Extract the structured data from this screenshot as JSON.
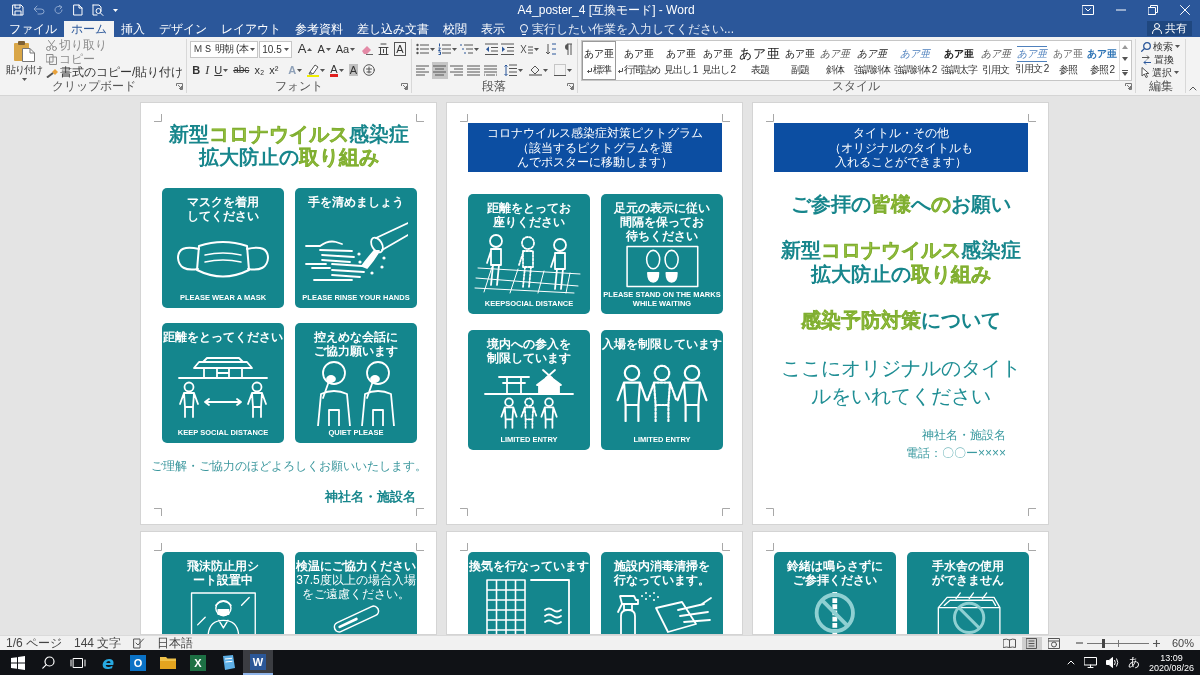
{
  "window": {
    "title": "A4_poster_4 [互換モード] - Word"
  },
  "menu_tabs": [
    {
      "label": "ファイル",
      "selected": false
    },
    {
      "label": "ホーム",
      "selected": true
    },
    {
      "label": "挿入",
      "selected": false
    },
    {
      "label": "デザイン",
      "selected": false
    },
    {
      "label": "レイアウト",
      "selected": false
    },
    {
      "label": "参考資料",
      "selected": false
    },
    {
      "label": "差し込み文書",
      "selected": false
    },
    {
      "label": "校閲",
      "selected": false
    },
    {
      "label": "表示",
      "selected": false
    }
  ],
  "tell_me": {
    "placeholder": "実行したい作業を入力してください..."
  },
  "share_button": {
    "label": "共有"
  },
  "clipboard": {
    "paste": "貼り付け",
    "actions": [
      {
        "kind": "cut",
        "label": "切り取り",
        "disabled": true
      },
      {
        "kind": "copy",
        "label": "コピー",
        "disabled": true
      },
      {
        "kind": "format_painter",
        "label": "書式のコピー/貼り付け",
        "disabled": false
      }
    ],
    "group_label": "クリップボード"
  },
  "font": {
    "font_name": "ＭＳ 明朝 (本",
    "font_size": "10.5",
    "row_1": [
      {
        "kind": "grow",
        "glyph": "A"
      },
      {
        "kind": "shrink",
        "glyph": "A"
      },
      {
        "kind": "case",
        "glyph": "Aa"
      },
      {
        "kind": "clear"
      },
      {
        "kind": "ruby"
      },
      {
        "kind": "border",
        "glyph": "A"
      }
    ],
    "row_2": [
      {
        "kind": "bold",
        "glyph": "B"
      },
      {
        "kind": "italic",
        "glyph": "I"
      },
      {
        "kind": "underline",
        "glyph": "U"
      },
      {
        "kind": "strike",
        "glyph": "abc"
      },
      {
        "kind": "subscript",
        "glyph": "x₂"
      },
      {
        "kind": "superscript",
        "glyph": "x²"
      },
      {
        "kind": "effects",
        "glyph": "A"
      },
      {
        "kind": "highlight"
      },
      {
        "kind": "color",
        "glyph": "A"
      },
      {
        "kind": "shading",
        "glyph": "A"
      },
      {
        "kind": "enclose"
      }
    ],
    "group_label": "フォント"
  },
  "paragraph": {
    "row_1": [
      {
        "kind": "bullets"
      },
      {
        "kind": "numbering"
      },
      {
        "kind": "multilevel"
      },
      {
        "kind": "outdent"
      },
      {
        "kind": "indent"
      },
      {
        "kind": "asian_layout"
      },
      {
        "kind": "sort"
      },
      {
        "kind": "marks"
      }
    ],
    "alignment": [
      {
        "kind": "left",
        "selected": false
      },
      {
        "kind": "center",
        "selected": true
      },
      {
        "kind": "right",
        "selected": false
      },
      {
        "kind": "justify",
        "selected": false
      },
      {
        "kind": "distribute",
        "selected": false
      }
    ],
    "row_2": [
      {
        "kind": "line_spacing"
      },
      {
        "kind": "shading"
      },
      {
        "kind": "borders"
      }
    ],
    "group_label": "段落"
  },
  "styles": {
    "items": [
      {
        "preview": "あア亜",
        "label": "標準",
        "kind": "normal",
        "paragraph_mark": true,
        "selected": true
      },
      {
        "preview": "あア亜",
        "label": "行間詰め",
        "kind": "normal",
        "paragraph_mark": true,
        "selected": false
      },
      {
        "preview": "あア亜",
        "label": "見出し 1",
        "kind": "heading",
        "paragraph_mark": false,
        "selected": false
      },
      {
        "preview": "あア亜",
        "label": "見出し 2",
        "kind": "heading",
        "paragraph_mark": false,
        "selected": false
      },
      {
        "preview": "あア亜",
        "label": "表題",
        "kind": "title",
        "paragraph_mark": false,
        "selected": false
      },
      {
        "preview": "あア亜",
        "label": "副題",
        "kind": "heading",
        "paragraph_mark": false,
        "selected": false
      },
      {
        "preview": "あア亜",
        "label": "斜体",
        "kind": "subtle_emphasis",
        "paragraph_mark": false,
        "selected": false
      },
      {
        "preview": "あア亜",
        "label": "強調斜体",
        "kind": "emphasis",
        "paragraph_mark": false,
        "selected": false
      },
      {
        "preview": "あア亜",
        "label": "強調斜体 2",
        "kind": "intense_emphasis",
        "paragraph_mark": false,
        "selected": false
      },
      {
        "preview": "あア亜",
        "label": "強調太字",
        "kind": "strong",
        "paragraph_mark": false,
        "selected": false
      },
      {
        "preview": "あア亜",
        "label": "引用文",
        "kind": "quote",
        "paragraph_mark": false,
        "selected": false
      },
      {
        "preview": "あア亜",
        "label": "引用文 2",
        "kind": "intense_quote",
        "paragraph_mark": false,
        "selected": false
      },
      {
        "preview": "あア亜",
        "label": "参照",
        "kind": "subtle_reference",
        "paragraph_mark": false,
        "selected": false
      },
      {
        "preview": "あア亜",
        "label": "参照 2",
        "kind": "intense_reference",
        "paragraph_mark": false,
        "selected": false
      }
    ],
    "group_label": "スタイル"
  },
  "editing": {
    "items": [
      {
        "kind": "find",
        "label": "検索"
      },
      {
        "kind": "replace",
        "label": "置換"
      },
      {
        "kind": "select",
        "label": "選択"
      }
    ],
    "group_label": "編集"
  },
  "pages": [
    {
      "kind": "poster",
      "heading": [
        [
          {
            "text": "新型",
            "highlight": false
          },
          {
            "text": "コロナウイルス",
            "highlight": true
          },
          {
            "text": "感染症",
            "highlight": false
          }
        ],
        [
          {
            "text": "拡大防止の",
            "highlight": false
          },
          {
            "text": "取り組み",
            "highlight": true
          }
        ]
      ],
      "cards": [
        {
          "kind": "mask",
          "title": [
            "マスクを着用してください"
          ],
          "caption": [
            "PLEASE WEAR A MASK"
          ]
        },
        {
          "kind": "hand_washing",
          "title": [
            "手を清めましょう"
          ],
          "caption": [
            "PLEASE RINSE YOUR HANDS"
          ]
        },
        {
          "kind": "distance",
          "title": [
            "距離をとってください"
          ],
          "caption": [
            "KEEP SOCIAL DISTANCE"
          ]
        },
        {
          "kind": "quiet",
          "title": [
            "控えめな会話に",
            "ご協力願います"
          ],
          "caption": [
            "QUIET PLEASE"
          ]
        }
      ],
      "message": "ご理解・ご協力のほどよろしくお願いいたします。",
      "facility": "神社名・施設名"
    },
    {
      "kind": "pictograms",
      "banner": {
        "title": "コロナウイルス感染症対策ピクトグラム",
        "subtitle": "（該当するピクトグラムを選んでポスターに移動します）"
      },
      "cards": [
        {
          "kind": "seated",
          "title": [
            "距離をとってお座りください"
          ],
          "caption": [
            "KEEPSOCIAL DISTANCE"
          ]
        },
        {
          "kind": "footprints",
          "title": [
            "足元の表示に従い",
            "間隔を保ってお待ちください"
          ],
          "caption": [
            "PLEASE STAND ON THE MARKS",
            "WHILE WAITING"
          ]
        },
        {
          "kind": "shrine_entry",
          "title": [
            "境内への参入を",
            "制限しています"
          ],
          "caption": [
            "LIMITED ENTRY"
          ]
        },
        {
          "kind": "entry",
          "title": [
            "入場を制限しています"
          ],
          "caption": [
            "LIMITED ENTRY"
          ]
        }
      ]
    },
    {
      "kind": "titles",
      "banner": {
        "title": "タイトル・その他",
        "subtitle": "（オリジナルのタイトルも入れることができます）"
      },
      "headings": [
        [
          [
            {
              "text": "ご参拝の",
              "highlight": false
            },
            {
              "text": "皆様",
              "highlight": true
            },
            {
              "text": "へ",
              "highlight": false
            },
            {
              "text": "の",
              "highlight": true
            },
            {
              "text": "お願い",
              "highlight": false
            }
          ]
        ],
        [
          [
            {
              "text": "新型",
              "highlight": false
            },
            {
              "text": "コロナウイルス",
              "highlight": true
            },
            {
              "text": "感染症",
              "highlight": false
            }
          ],
          [
            {
              "text": "拡大防止の",
              "highlight": false
            },
            {
              "text": "取り組み",
              "highlight": true
            }
          ]
        ],
        [
          [
            {
              "text": "感染予防対策",
              "highlight": true
            },
            {
              "text": "について",
              "highlight": false
            }
          ]
        ]
      ],
      "custom_title": "ここにオリジナルのタイトルをいれてください",
      "facility": "神社名・施設名",
      "phone": "電話：〇〇ー××××"
    }
  ],
  "next_pages": [
    {
      "cards": [
        {
          "kind": "partition",
          "title": [
            "飛沫防止用シート設置中"
          ]
        },
        {
          "kind": "thermometer",
          "title": [
            "検温にご協力ください"
          ],
          "note": "37.5度以上の場合入場をご遠慮ください。"
        }
      ]
    },
    {
      "cards": [
        {
          "kind": "ventilation",
          "title": [
            "換気を行なっています"
          ]
        },
        {
          "kind": "disinfection",
          "title": [
            "施設内消毒清掃を",
            "行なっています。"
          ]
        }
      ]
    },
    {
      "cards": [
        {
          "kind": "bell_rope",
          "title": [
            "鈴緒は鳴らさずに",
            "ご参拝ください"
          ]
        },
        {
          "kind": "basin",
          "title": [
            "手水舎の使用ができません"
          ]
        }
      ]
    }
  ],
  "status_bar": {
    "page": "1/6 ページ",
    "words": "144 文字",
    "language": "日本語",
    "views": [
      {
        "kind": "read",
        "selected": false
      },
      {
        "kind": "print",
        "selected": true
      },
      {
        "kind": "web",
        "selected": false
      }
    ],
    "zoom": {
      "level": 0.27,
      "label": "60%"
    }
  },
  "taskbar": {
    "apps": [
      {
        "kind": "ie",
        "glyph": "e",
        "selected": false
      },
      {
        "kind": "outlook",
        "glyph": "O",
        "selected": false
      },
      {
        "kind": "explorer",
        "selected": false
      },
      {
        "kind": "excel",
        "glyph": "X",
        "selected": false
      },
      {
        "kind": "notebook",
        "selected": false
      },
      {
        "kind": "word",
        "glyph": "W",
        "selected": true
      }
    ],
    "ime": "あ",
    "time": "13:09",
    "date": "2020/08/26"
  }
}
